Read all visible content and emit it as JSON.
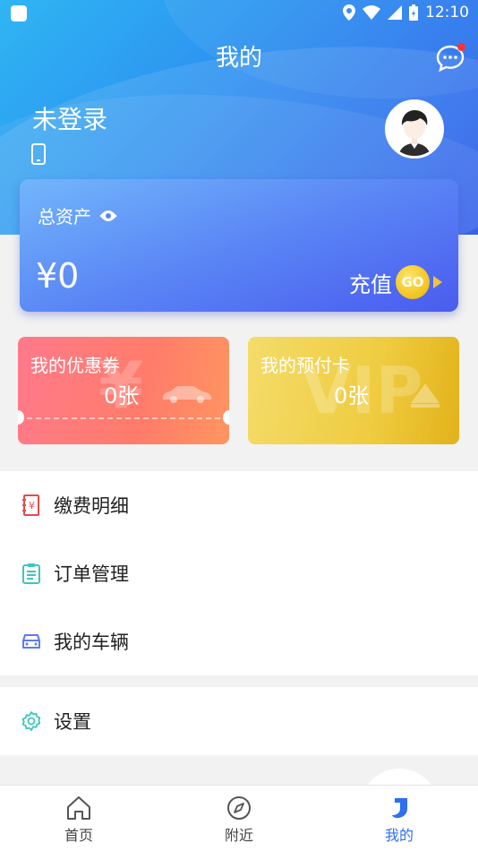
{
  "status_bar": {
    "time": "12:10"
  },
  "header": {
    "title": "我的"
  },
  "user": {
    "name": "未登录"
  },
  "assets": {
    "label": "总资产",
    "value": "¥0",
    "recharge_label": "充值",
    "go_label": "GO"
  },
  "tickets": [
    {
      "title": "我的优惠券",
      "count": "0张",
      "watermark": "¥"
    },
    {
      "title": "我的预付卡",
      "count": "0张",
      "watermark": "VIP"
    }
  ],
  "menu": {
    "items": [
      {
        "label": "缴费明细",
        "icon": "receipt-icon",
        "color": "#e84b4b"
      },
      {
        "label": "订单管理",
        "icon": "clipboard-icon",
        "color": "#3ec7b8"
      },
      {
        "label": "我的车辆",
        "icon": "car-icon",
        "color": "#5b7cf0"
      }
    ],
    "settings": {
      "label": "设置",
      "icon": "gear-icon",
      "color": "#3ec7b8"
    }
  },
  "nav": {
    "tabs": [
      {
        "label": "首页",
        "icon": "home-icon"
      },
      {
        "label": "附近",
        "icon": "compass-icon"
      },
      {
        "label": "我的",
        "icon": "user-drop-icon"
      }
    ]
  },
  "colors": {
    "accent": "#2f6ff0",
    "header_start": "#2fb6f3",
    "header_end": "#2b56e8"
  }
}
